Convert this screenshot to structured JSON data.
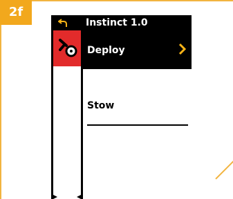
{
  "step": {
    "label": "2f"
  },
  "device": {
    "title": "Instinct 1.0",
    "menu": [
      {
        "label": "Deploy",
        "selected": true
      },
      {
        "label": "Stow",
        "selected": false
      }
    ],
    "icons": {
      "back": "back-arrow-icon",
      "sidebar": "trolling-motor-icon",
      "chevron": "chevron-right-icon"
    }
  },
  "colors": {
    "accent": "#f2a81d",
    "sidebar_highlight": "#e22b2b",
    "selected_bg": "#000000",
    "chevron": "#f6b317"
  }
}
